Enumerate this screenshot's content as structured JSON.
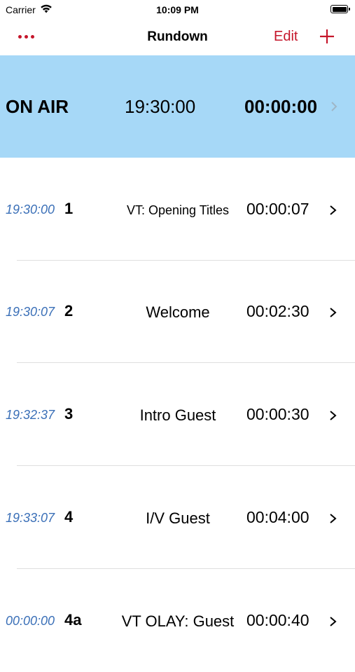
{
  "status_bar": {
    "carrier": "Carrier",
    "time": "10:09 PM",
    "battery_level": 1.0
  },
  "nav": {
    "title": "Rundown",
    "edit_label": "Edit",
    "more_icon": "ellipsis-icon",
    "add_icon": "plus-icon",
    "accent_color": "#c5162b"
  },
  "on_air": {
    "label": "ON AIR",
    "clock": "19:30:00",
    "duration": "00:00:00",
    "background_color": "#a6d8f7"
  },
  "rows": [
    {
      "start": "19:30:00",
      "number": "1",
      "title": "VT: Opening Titles",
      "duration": "00:00:07"
    },
    {
      "start": "19:30:07",
      "number": "2",
      "title": "Welcome",
      "duration": "00:02:30"
    },
    {
      "start": "19:32:37",
      "number": "3",
      "title": "Intro Guest",
      "duration": "00:00:30"
    },
    {
      "start": "19:33:07",
      "number": "4",
      "title": "I/V Guest",
      "duration": "00:04:00"
    },
    {
      "start": "00:00:00",
      "number": "4a",
      "title": "VT OLAY: Guest",
      "duration": "00:00:40"
    }
  ]
}
